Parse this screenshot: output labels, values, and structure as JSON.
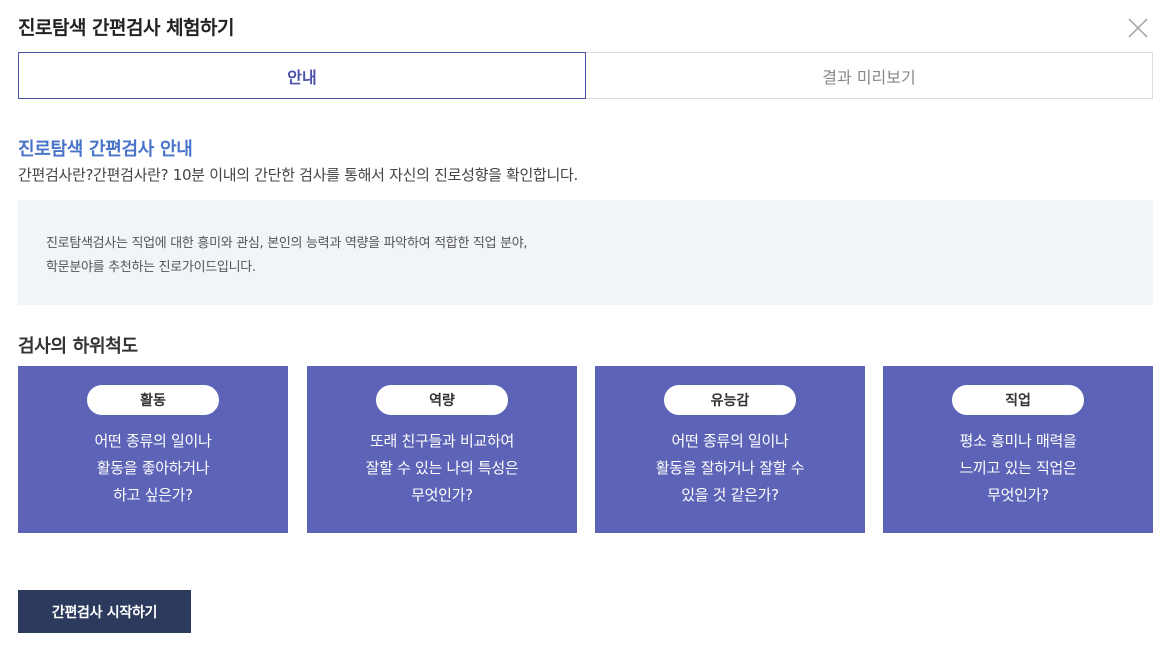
{
  "modal": {
    "title": "진로탐색 간편검사 체험하기",
    "close_icon": "close-icon"
  },
  "tabs": [
    {
      "label": "안내",
      "active": true
    },
    {
      "label": "결과 미리보기",
      "active": false
    }
  ],
  "guide": {
    "title": "진로탐색 간편검사 안내",
    "intro": "간편검사란?간편검사란? 10분 이내의 간단한 검사를 통해서 자신의 진로성향을 확인합니다.",
    "info_lines": [
      "진로탐색검사는 직업에 대한 흥미와 관심, 본인의 능력과 역량을 파악하여 적합한 직업 분야,",
      "학문분야를 추천하는 진로가이드입니다."
    ]
  },
  "subscales": {
    "title": "검사의 하위척도",
    "cards": [
      {
        "badge": "활동",
        "lines": [
          "어떤 종류의 일이나",
          "활동을 좋아하거나",
          "하고 싶은가?"
        ]
      },
      {
        "badge": "역량",
        "lines": [
          "또래 친구들과 비교하여",
          "잘할 수 있는 나의 특성은",
          "무엇인가?"
        ]
      },
      {
        "badge": "유능감",
        "lines": [
          "어떤 종류의 일이나",
          "활동을 잘하거나 잘할 수",
          "있을 것 같은가?"
        ]
      },
      {
        "badge": "직업",
        "lines": [
          "평소 흥미나 매력을",
          "느끼고 있는 직업은",
          "무엇인가?"
        ]
      }
    ]
  },
  "start_button": {
    "label": "간편검사 시작하기"
  },
  "colors": {
    "accent": "#4a52a8",
    "card_bg": "#5d63b6",
    "info_bg": "#f1f4f8",
    "button_bg": "#2c3a5e",
    "section_title": "#4a74c9"
  }
}
